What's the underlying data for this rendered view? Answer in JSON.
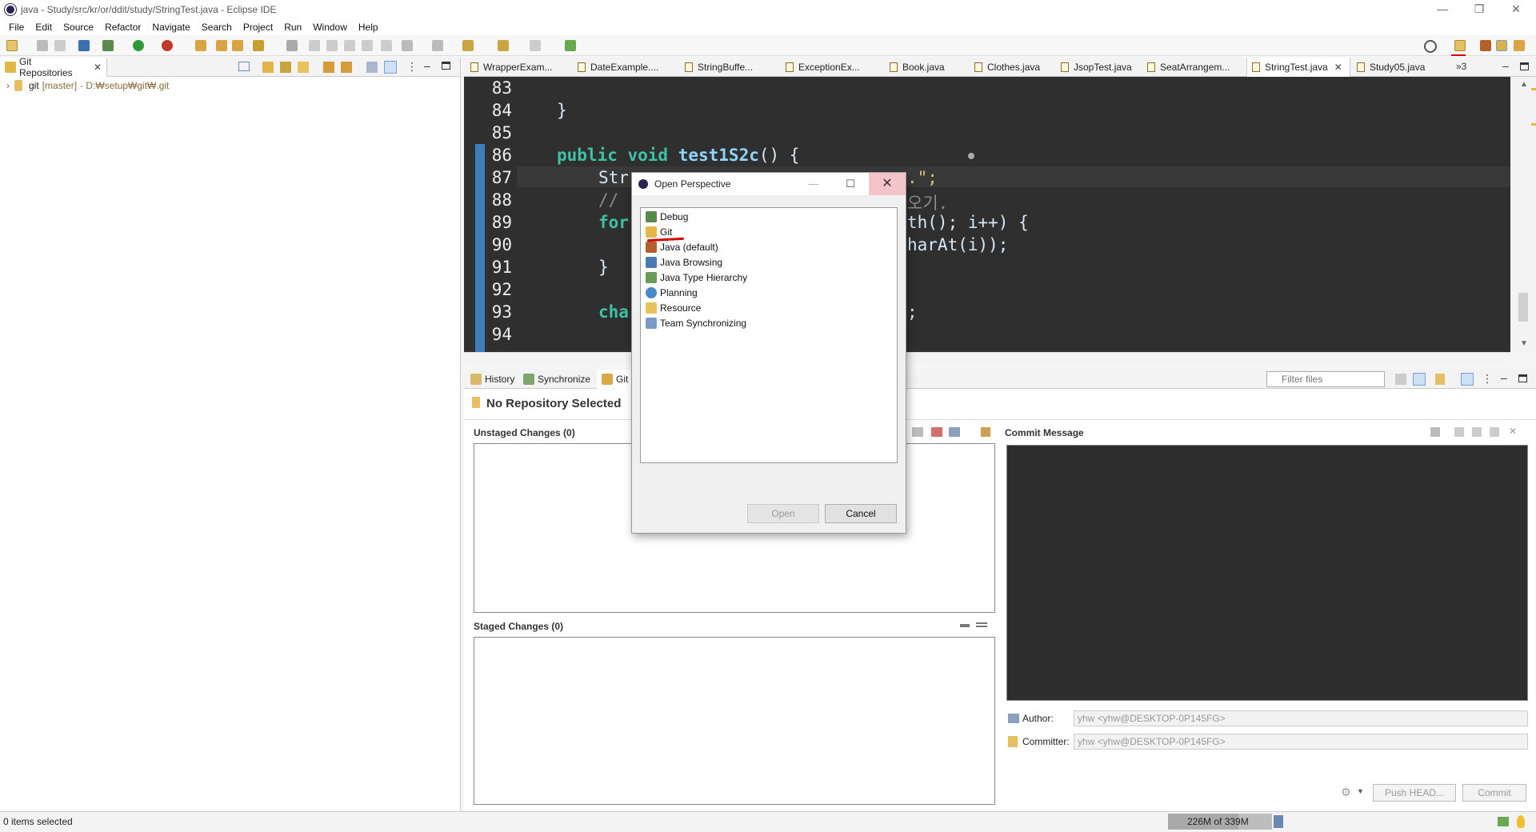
{
  "window": {
    "title": "java - Study/src/kr/or/ddit/study/StringTest.java - Eclipse IDE"
  },
  "menu": [
    "File",
    "Edit",
    "Source",
    "Refactor",
    "Navigate",
    "Search",
    "Project",
    "Run",
    "Window",
    "Help"
  ],
  "left_panel": {
    "tab_label": "Git Repositories",
    "repo_name": "git",
    "repo_branch": "[master]",
    "repo_path": "- D:₩setup₩git₩.git"
  },
  "editor_tabs": [
    "WrapperExam...",
    "DateExample....",
    "StringBuffe...",
    "ExceptionEx...",
    "Book.java",
    "Clothes.java",
    "JsopTest.java",
    "SeatArrangem...",
    "StringTest.java",
    "Study05.java"
  ],
  "editor_overflow": "»3",
  "code_lines": {
    "n83": "83",
    "n84": "84",
    "n85": "85",
    "n86": "86",
    "n87": "87",
    "n88": "88",
    "n89": "89",
    "n90": "90",
    "n91": "91",
    "n92": "92",
    "n93": "93",
    "n94": "94",
    "c84": "}",
    "c86_kw": "public void ",
    "c86_fn": "test1S2c",
    "c86_rest": "() {",
    "c87": "Str",
    "c87_end": ".\";",
    "c88": "//",
    "c88_end": "오기.",
    "c89_kw": "for",
    "c89_end": "th(); i++) {",
    "c90_end": "harAt(i));",
    "c91": "}",
    "c93_kw": "cha",
    "c93_end": ";"
  },
  "bottom_tabs": [
    "History",
    "Synchronize",
    "Git S"
  ],
  "filter_placeholder": "Filter files",
  "staging": {
    "header": "No Repository Selected",
    "unstaged": "Unstaged Changes (0)",
    "staged": "Staged Changes (0)",
    "commit_message": "Commit Message",
    "author_label": "Author:",
    "author_value": "yhw <yhw@DESKTOP-0P145FG>",
    "committer_label": "Committer:",
    "committer_value": "yhw <yhw@DESKTOP-0P145FG>",
    "push_button": "Push HEAD...",
    "commit_button": "Commit"
  },
  "status": {
    "selection": "0 items selected",
    "memory": "226M of 339M"
  },
  "dialog": {
    "title": "Open Perspective",
    "items": [
      "Debug",
      "Git",
      "Java (default)",
      "Java Browsing",
      "Java Type Hierarchy",
      "Planning",
      "Resource",
      "Team Synchronizing"
    ],
    "open_button": "Open",
    "cancel_button": "Cancel"
  },
  "colors": {
    "editor_bg": "#2f2f2f",
    "keyword": "#cc7832",
    "function": "#6fc3ff",
    "close_hover": "#f4c5c8",
    "annotation_red": "#d40000"
  }
}
